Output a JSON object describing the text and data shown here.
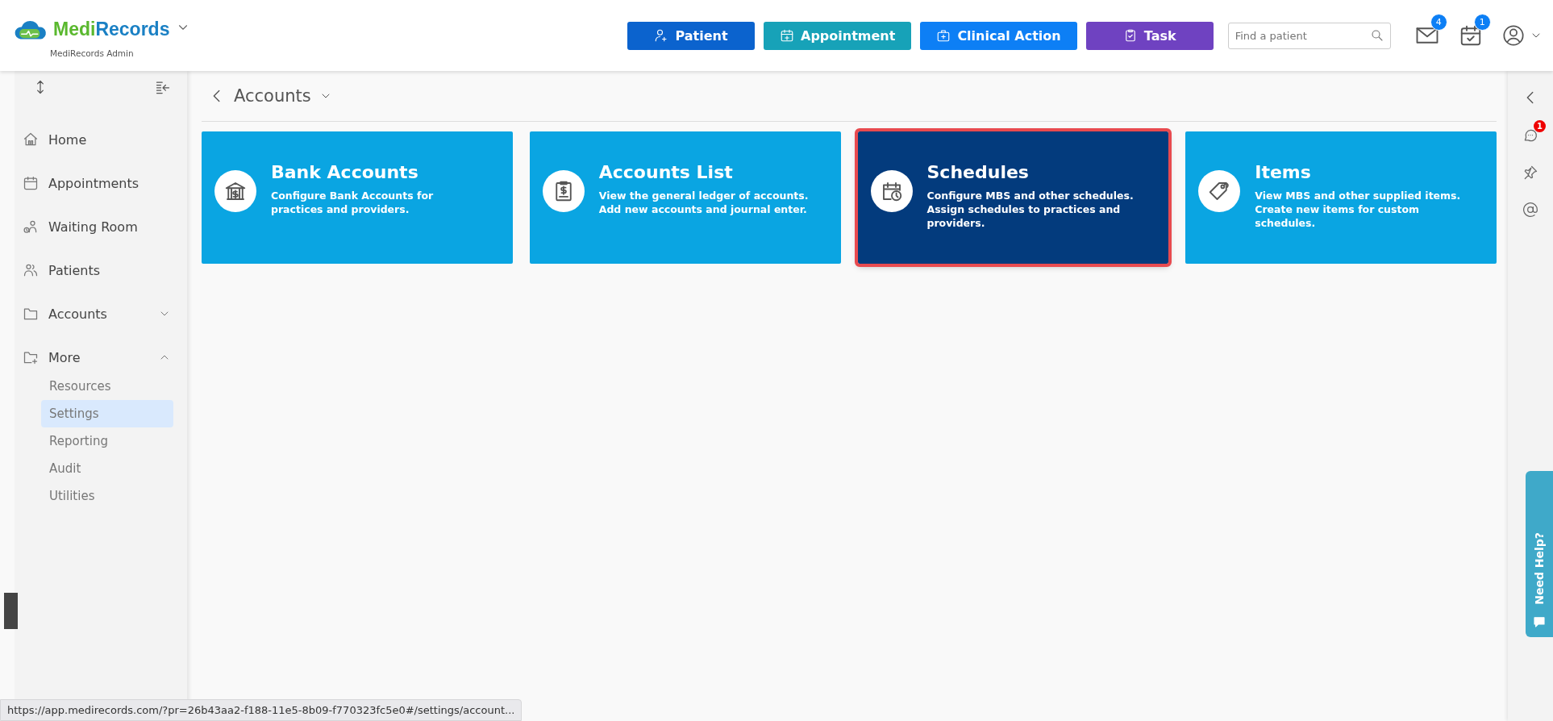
{
  "header": {
    "brand_prefix": "Medi",
    "brand_suffix": "Records",
    "subtitle": "MediRecords Admin",
    "actions": [
      {
        "kind": "patient",
        "label": "Patient",
        "color": "#0b63ce"
      },
      {
        "kind": "appointment",
        "label": "Appointment",
        "color": "#17a2b8"
      },
      {
        "kind": "clinical",
        "label": "Clinical Action",
        "color": "#0d7ff5"
      },
      {
        "kind": "task",
        "label": "Task",
        "color": "#6f42c1"
      }
    ],
    "search": {
      "placeholder": "Find a patient"
    },
    "mail_badge": "4",
    "calendar_badge": "1"
  },
  "sidebar": {
    "items": [
      {
        "kind": "home",
        "label": "Home"
      },
      {
        "kind": "calendar",
        "label": "Appointments"
      },
      {
        "kind": "waiting",
        "label": "Waiting Room"
      },
      {
        "kind": "people",
        "label": "Patients"
      },
      {
        "kind": "folder",
        "label": "Accounts",
        "expanded": false
      },
      {
        "kind": "folder-plus",
        "label": "More",
        "expanded": true,
        "children": [
          {
            "label": "Resources",
            "selected": false
          },
          {
            "label": "Settings",
            "selected": true
          },
          {
            "label": "Reporting",
            "selected": false
          },
          {
            "label": "Audit",
            "selected": false
          },
          {
            "label": "Utilities",
            "selected": false
          }
        ]
      }
    ]
  },
  "page": {
    "title": "Accounts"
  },
  "cards": [
    {
      "kind": "bank",
      "title": "Bank Accounts",
      "description": "Configure Bank Accounts for practices and providers.",
      "selected": false
    },
    {
      "kind": "ledger",
      "title": "Accounts List",
      "description": "View the general ledger of accounts. Add new accounts and journal enter.",
      "selected": false
    },
    {
      "kind": "schedule",
      "title": "Schedules",
      "description": "Configure MBS and other schedules. Assign schedules to practices and providers.",
      "selected": true
    },
    {
      "kind": "tag",
      "title": "Items",
      "description": "View MBS and other supplied items. Create new items for custom schedules.",
      "selected": false
    }
  ],
  "rail": {
    "chat_badge": "1",
    "help": "Need Help?"
  },
  "status_bar": {
    "url": "https://app.medirecords.com/?pr=26b43aa2-f188-11e5-8b09-f770323fc5e0#/settings/account..."
  }
}
